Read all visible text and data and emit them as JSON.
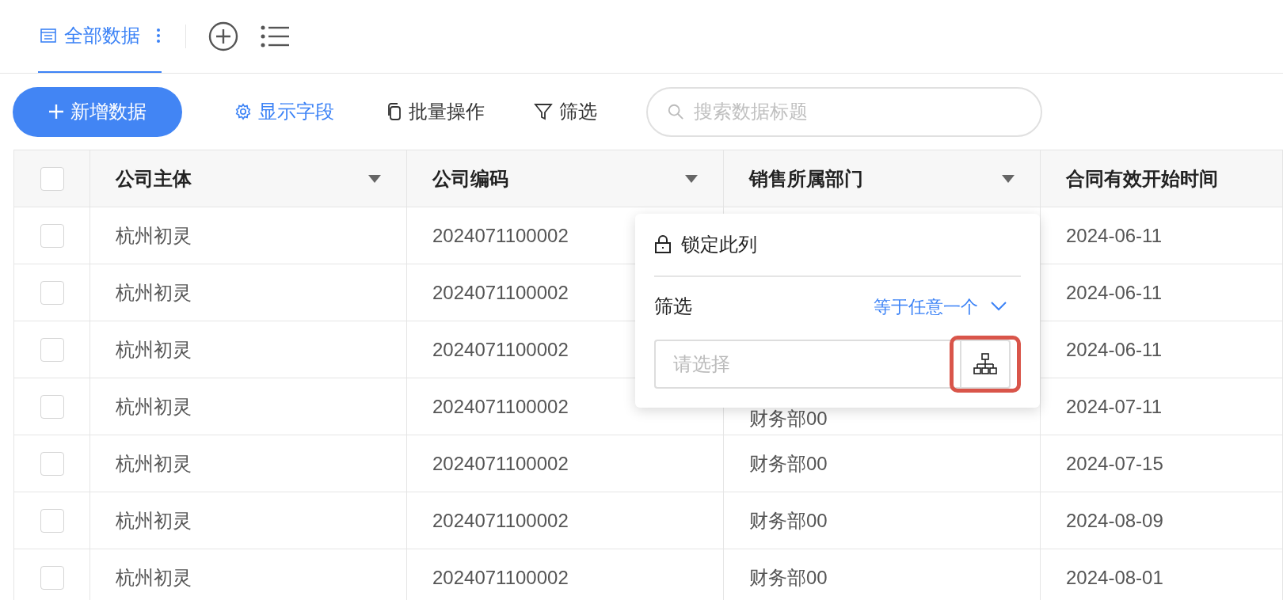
{
  "view_tabs": [
    {
      "label": "全部数据",
      "selected": true
    }
  ],
  "toolbar": {
    "add_button": "新增数据",
    "fields_button": "显示字段",
    "batch_button": "批量操作",
    "filter_button": "筛选",
    "search": {
      "placeholder": "搜索数据标题"
    }
  },
  "table": {
    "select_all": {
      "checked": false
    },
    "columns": [
      "公司主体",
      "公司编码",
      "销售所属部门",
      "合同有效开始时间"
    ],
    "rows": [
      {
        "checked": false,
        "cells": [
          "杭州初灵",
          "2024071100002",
          "",
          "2024-06-11"
        ]
      },
      {
        "checked": false,
        "cells": [
          "杭州初灵",
          "2024071100002",
          "",
          "2024-06-11"
        ]
      },
      {
        "checked": false,
        "cells": [
          "杭州初灵",
          "2024071100002",
          "",
          "2024-06-11"
        ]
      },
      {
        "checked": false,
        "cells": [
          "杭州初灵",
          "2024071100002",
          "财务部00",
          "2024-07-11"
        ]
      },
      {
        "checked": false,
        "cells": [
          "杭州初灵",
          "2024071100002",
          "财务部00",
          "2024-07-15"
        ]
      },
      {
        "checked": false,
        "cells": [
          "杭州初灵",
          "2024071100002",
          "财务部00",
          "2024-08-09"
        ]
      },
      {
        "checked": false,
        "cells": [
          "杭州初灵",
          "2024071100002",
          "财务部00",
          "2024-08-01"
        ]
      }
    ]
  },
  "column_menu": {
    "lock_item": "锁定此列",
    "filter_label": "筛选",
    "operator": "等于任意一个",
    "select": {
      "placeholder": "请选择"
    },
    "tree_button_highlighted": true
  }
}
